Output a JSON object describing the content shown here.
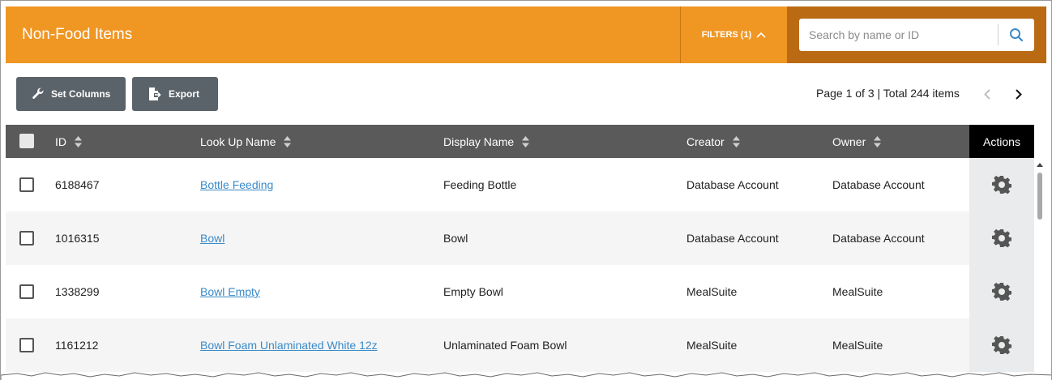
{
  "header": {
    "title": "Non-Food Items",
    "filters_label": "FILTERS (1)",
    "accent": "#f09623",
    "search_zone_color": "#b96a12"
  },
  "search": {
    "placeholder": "Search by name or ID",
    "value": "",
    "icon": "search-icon"
  },
  "toolbar": {
    "set_columns_label": "Set Columns",
    "set_columns_icon": "wrench-icon",
    "export_label": "Export",
    "export_icon": "export-file-icon"
  },
  "pagination": {
    "text": "Page 1 of 3 | Total 244 items",
    "prev_icon": "chevron-left-icon",
    "next_icon": "chevron-right-icon"
  },
  "table": {
    "columns": [
      "ID",
      "Look Up Name",
      "Display Name",
      "Creator",
      "Owner",
      "Actions"
    ],
    "rows": [
      {
        "id": "6188467",
        "lookup": "Bottle Feeding",
        "display": "Feeding Bottle",
        "creator": "Database Account",
        "owner": "Database Account"
      },
      {
        "id": "1016315",
        "lookup": "Bowl",
        "display": "Bowl",
        "creator": "Database Account",
        "owner": "Database Account"
      },
      {
        "id": "1338299",
        "lookup": "Bowl Empty",
        "display": "Empty Bowl",
        "creator": "MealSuite",
        "owner": "MealSuite"
      },
      {
        "id": "1161212",
        "lookup": "Bowl Foam Unlaminated White 12z",
        "display": "Unlaminated Foam Bowl",
        "creator": "MealSuite",
        "owner": "MealSuite"
      }
    ],
    "row_action_icon": "gear-icon",
    "link_color": "#3a8ac9",
    "header_bg": "#5a5a5a"
  }
}
